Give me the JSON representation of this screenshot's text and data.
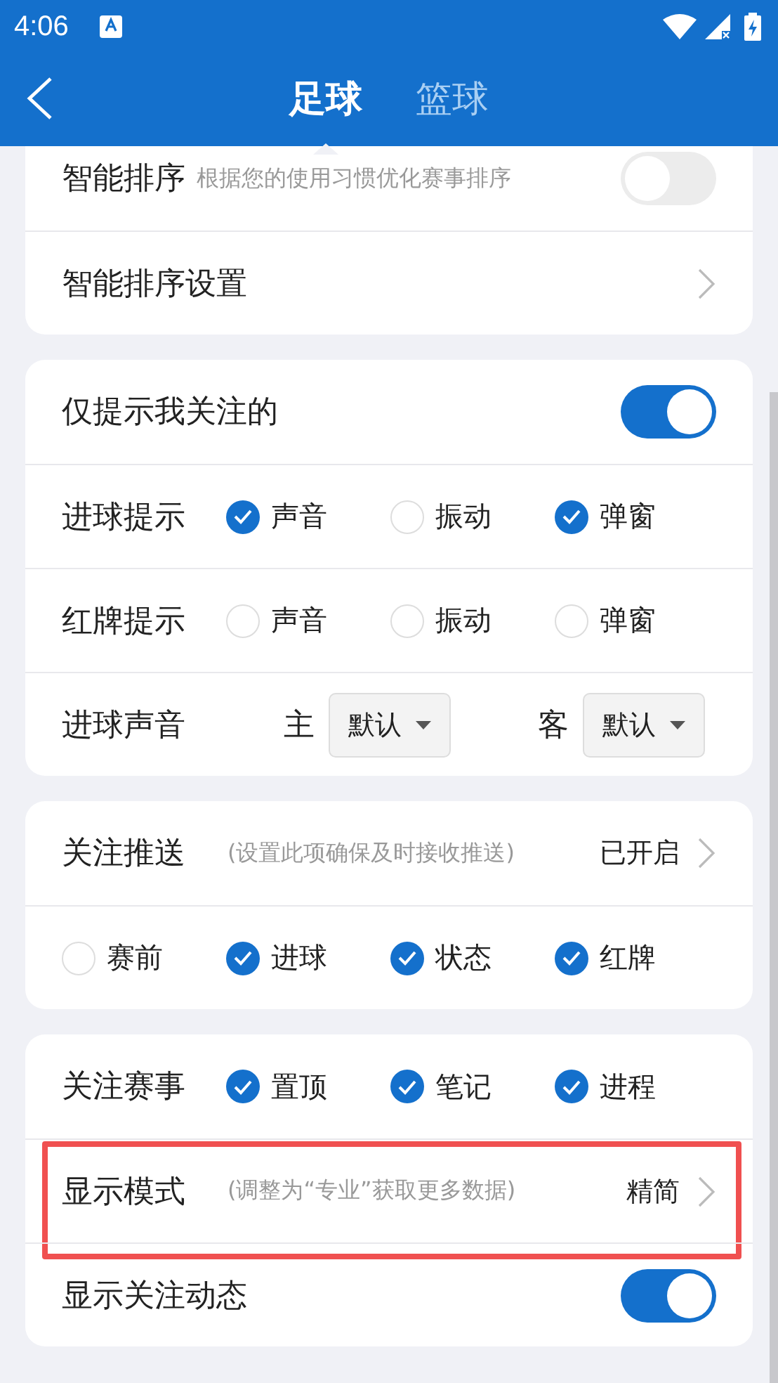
{
  "status_bar": {
    "time": "4:06"
  },
  "nav": {
    "tabs": [
      {
        "label": "足球",
        "selected": true
      },
      {
        "label": "篮球",
        "selected": false
      }
    ]
  },
  "sections": [
    {
      "rows": [
        {
          "kind": "toggle",
          "label": "智能排序",
          "hint": "根据您的使用习惯优化赛事排序",
          "on": false
        },
        {
          "kind": "link",
          "label": "智能排序设置"
        }
      ]
    },
    {
      "rows": [
        {
          "kind": "toggle",
          "label": "仅提示我关注的",
          "on": true
        },
        {
          "kind": "checks",
          "label": "进球提示",
          "options": [
            {
              "label": "声音",
              "checked": true
            },
            {
              "label": "振动",
              "checked": false
            },
            {
              "label": "弹窗",
              "checked": true
            }
          ]
        },
        {
          "kind": "checks",
          "label": "红牌提示",
          "options": [
            {
              "label": "声音",
              "checked": false
            },
            {
              "label": "振动",
              "checked": false
            },
            {
              "label": "弹窗",
              "checked": false
            }
          ]
        },
        {
          "kind": "sound",
          "label": "进球声音",
          "home_label": "主",
          "home_value": "默认",
          "away_label": "客",
          "away_value": "默认"
        }
      ]
    },
    {
      "rows": [
        {
          "kind": "link",
          "label": "关注推送",
          "hint": "(设置此项确保及时接收推送)",
          "value": "已开启"
        },
        {
          "kind": "checks",
          "options": [
            {
              "label": "赛前",
              "checked": false
            },
            {
              "label": "进球",
              "checked": true
            },
            {
              "label": "状态",
              "checked": true
            },
            {
              "label": "红牌",
              "checked": true
            }
          ]
        }
      ]
    },
    {
      "rows": [
        {
          "kind": "checks",
          "label": "关注赛事",
          "options": [
            {
              "label": "置顶",
              "checked": true
            },
            {
              "label": "笔记",
              "checked": true
            },
            {
              "label": "进程",
              "checked": true
            }
          ]
        },
        {
          "kind": "link",
          "label": "显示模式",
          "hint": "(调整为“专业”获取更多数据)",
          "value": "精简",
          "highlighted": true
        },
        {
          "kind": "toggle",
          "label": "显示关注动态",
          "on": true
        }
      ]
    }
  ]
}
